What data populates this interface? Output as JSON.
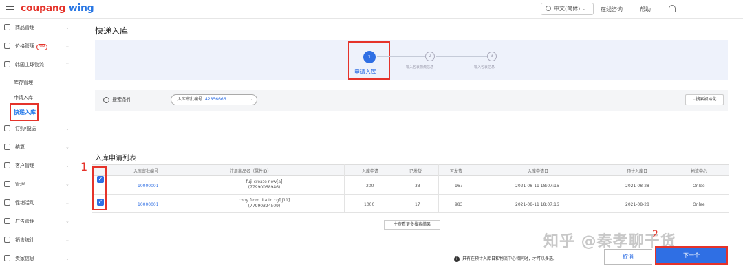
{
  "topbar": {
    "logo_main": "coupang",
    "logo_accent": "wing",
    "language": "中文(简体)",
    "chat_link": "在线咨询",
    "help_link": "帮助"
  },
  "sidebar": {
    "items": [
      {
        "label": "商品管理"
      },
      {
        "label": "价格管理",
        "badge": "new"
      },
      {
        "label": "韩国主球物流"
      },
      {
        "label": "订购/配送"
      },
      {
        "label": "结算"
      },
      {
        "label": "客户管理"
      },
      {
        "label": "管理"
      },
      {
        "label": "促销活动"
      },
      {
        "label": "广告管理"
      },
      {
        "label": "销售统计"
      },
      {
        "label": "卖家信息"
      }
    ],
    "subitems": [
      "库存管理",
      "申请入库",
      "快递入库"
    ]
  },
  "page": {
    "title": "快递入库",
    "steps": [
      {
        "num": "1",
        "label": "申请入库"
      },
      {
        "num": "2",
        "label": "输入包裹物流信息"
      },
      {
        "num": "3",
        "label": "输入包裹信息"
      }
    ]
  },
  "search": {
    "label": "搜索条件",
    "field_label": "入库审批编号",
    "field_value": "42856666...",
    "reset_label": "搜索初始化"
  },
  "list": {
    "title": "入库申请列表",
    "headers": [
      "入库审批编号",
      "注册商品名（属性ID）",
      "入库申请",
      "已发货",
      "可发货",
      "入库申请日",
      "预计入库日",
      "物流中心"
    ],
    "rows": [
      {
        "id": "10000001",
        "name": "fuji create new[a]",
        "name_id": "(77990068946)",
        "apply": "200",
        "shipped": "33",
        "available": "167",
        "apply_date": "2021-08-11 18:07:16",
        "eta": "2021-08-28",
        "center": "Onlee"
      },
      {
        "id": "10000001",
        "name": "copy from lita to cgf[j11]",
        "name_id": "(77990324509)",
        "apply": "1000",
        "shipped": "17",
        "available": "983",
        "apply_date": "2021-08-11 18:07:16",
        "eta": "2021-08-28",
        "center": "Onlee"
      }
    ],
    "more_label": "十查看更多搜索结果"
  },
  "footer": {
    "note": "只有在预计入库日和物流中心相同时，才可以多选。",
    "cancel_label": "取消",
    "next_label": "下一个"
  },
  "annotations": {
    "one": "1",
    "two": "2"
  },
  "watermark": "知乎 @秦孝聊干货",
  "colors": {
    "accent": "#2f6fe4",
    "highlight": "#e5332a"
  }
}
